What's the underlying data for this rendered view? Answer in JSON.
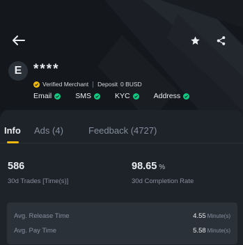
{
  "header": {
    "avatar_initial": "E",
    "user_name": "****",
    "merchant_label": "Verified Merchant",
    "deposit_label": "Deposit",
    "deposit_value": "0 BUSD",
    "verifications": [
      {
        "label": "Email",
        "icon": "check-circle-icon"
      },
      {
        "label": "SMS",
        "icon": "check-circle-icon"
      },
      {
        "label": "KYC",
        "icon": "check-circle-icon"
      },
      {
        "label": "Address",
        "icon": "check-circle-icon"
      }
    ],
    "icons": {
      "back": "back-arrow-icon",
      "favorite": "star-icon",
      "share": "share-icon"
    }
  },
  "tabs": [
    {
      "label": "Info",
      "active": true
    },
    {
      "label": "Ads (4)",
      "active": false
    },
    {
      "label": "Feedback (4727)",
      "active": false
    }
  ],
  "stats": {
    "trades": {
      "value": "586",
      "label": "30d Trades [Time(s)]"
    },
    "completion": {
      "value": "98.65",
      "unit": "%",
      "label": "30d Completion Rate"
    }
  },
  "times": [
    {
      "label": "Avg. Release Time",
      "value": "4.55",
      "unit": "Minute(s)"
    },
    {
      "label": "Avg. Pay Time",
      "value": "5.58",
      "unit": "Minute(s)"
    }
  ],
  "colors": {
    "accent": "#f0b90b",
    "success": "#0ecb81",
    "panel": "#1e2329",
    "header_bg": "#14171c"
  }
}
